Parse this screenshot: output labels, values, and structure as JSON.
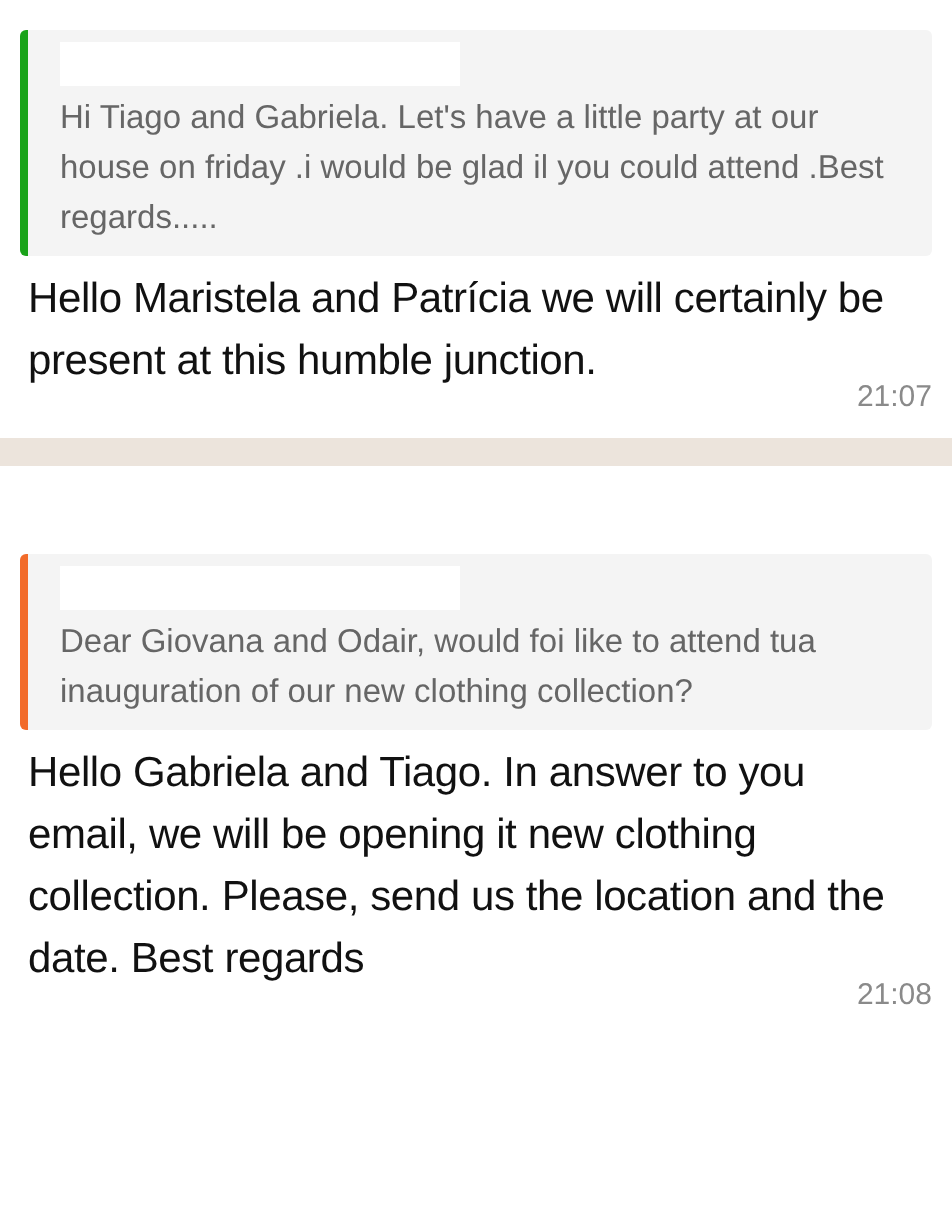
{
  "messages": [
    {
      "quote": {
        "text": "Hi Tiago and Gabriela. Let's have a little party at our house on friday .i would be glad il you could attend .Best regards.....",
        "color": "#1aa31a"
      },
      "text": "Hello Maristela and Patrícia we will certainly be present at this humble junction.",
      "time": "21:07"
    },
    {
      "quote": {
        "text": "Dear Giovana and Odair, would foi like to attend tua inauguration of our new clothing collection?",
        "color": "#f26b2a"
      },
      "text": "Hello Gabriela and Tiago. In answer to you email, we will be opening it new clothing  collection. Please, send us the location and the date. Best regards",
      "time": "21:08"
    }
  ]
}
